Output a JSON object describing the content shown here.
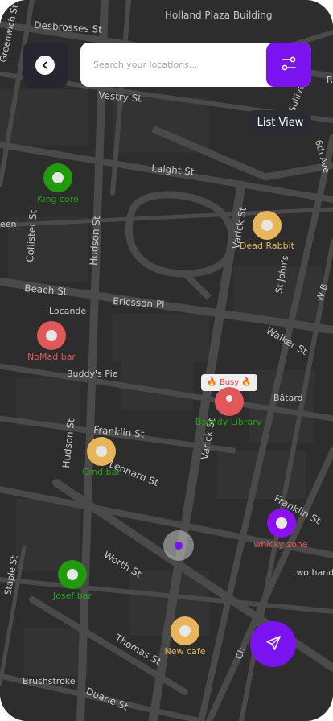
{
  "search": {
    "placeholder": "Search your locations..."
  },
  "list_view_label": "List View",
  "busy_badge": "🔥 Busy 🔥",
  "streets": [
    "Desbrosses St",
    "Holland Plaza Building",
    "Vestry St",
    "Laight St",
    "Hudson St",
    "Varick St",
    "Collister St",
    "Beach St",
    "Locande",
    "Ericsson Pl",
    "Walker St",
    "St John's",
    "Buddy's Pie",
    "Bâtard",
    "Franklin St",
    "Leonard St",
    "Franklin St",
    "two hands",
    "Worth St",
    "Thomas St",
    "Staple St",
    "Hudson St",
    "Varick St",
    "Brushstroke",
    "Duane St",
    "Greenwich St",
    "6th Ave",
    "Sullivan St",
    "een",
    "W B",
    "Ch"
  ],
  "markers": [
    {
      "name": "King core",
      "color": "green"
    },
    {
      "name": "Dead Rabbit",
      "color": "gold"
    },
    {
      "name": "NoMad bar",
      "color": "red"
    },
    {
      "name": "Bsandy Library",
      "color": "red"
    },
    {
      "name": "Crnd bar",
      "color": "gold"
    },
    {
      "name": "whicky zone",
      "color": "purple"
    },
    {
      "name": "Josef bar",
      "color": "green"
    },
    {
      "name": "New cafe",
      "color": "gold"
    }
  ],
  "icons": {
    "back": "chevron-left-icon",
    "filter": "filter-sliders-icon",
    "navigate": "paper-plane-icon"
  },
  "colors": {
    "accent": "#7b12f0",
    "green": "#1f9b0c",
    "gold": "#e8b55a",
    "red": "#e25757",
    "map_bg": "#2c2c2c"
  }
}
